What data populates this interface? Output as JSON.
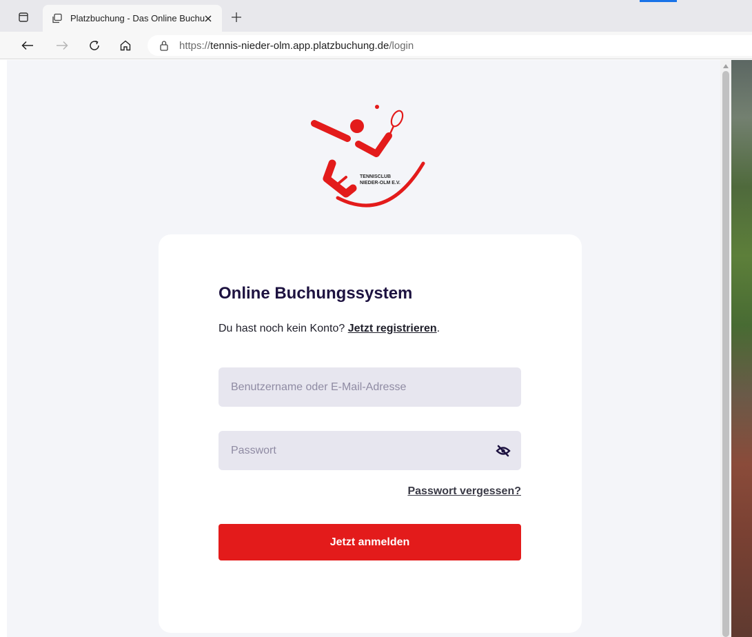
{
  "browser": {
    "tab_title": "Platzbuchung - Das Online Buchu",
    "url_prefix": "https://",
    "url_domain": "tennis-nieder-olm.app.platzbuchung.de",
    "url_path": "/login",
    "icons": {
      "tab_actions": "tab-actions-icon",
      "favicon": "tab-favicon-icon",
      "close": "close-icon",
      "new_tab": "plus-icon",
      "back": "arrow-left-icon",
      "forward": "arrow-right-icon",
      "reload": "reload-icon",
      "home": "home-icon",
      "lock": "lock-icon"
    }
  },
  "logo": {
    "line1": "TENNISCLUB",
    "line2": "NIEDER-OLM E.V.",
    "color": "#e31b1b"
  },
  "login": {
    "heading": "Online Buchungssystem",
    "no_account_text": "Du hast noch kein Konto?",
    "register_link": "Jetzt registrieren",
    "register_suffix": ".",
    "username_placeholder": "Benutzername oder E-Mail-Adresse",
    "username_value": "",
    "password_placeholder": "Passwort",
    "password_value": "",
    "forgot_link": "Passwort vergessen?",
    "submit_label": "Jetzt anmelden",
    "icons": {
      "toggle_password": "eye-slash-icon"
    }
  },
  "colors": {
    "accent": "#e31b1b",
    "heading": "#1d1240",
    "field_bg": "#e7e6ef",
    "page_bg": "#f4f5f9"
  }
}
